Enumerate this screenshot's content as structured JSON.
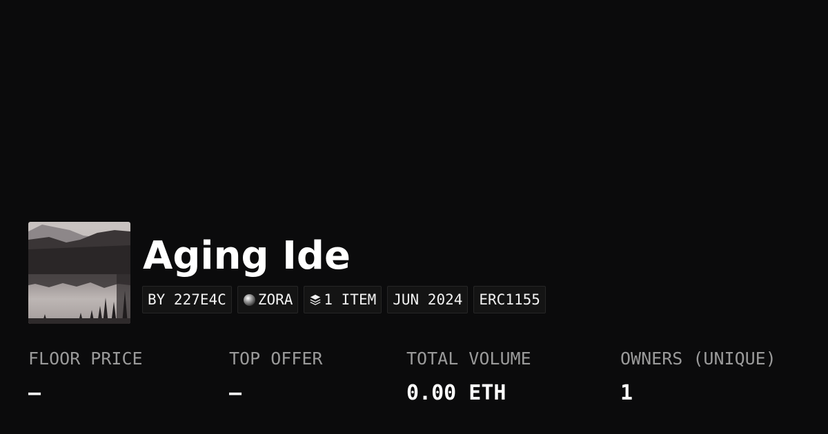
{
  "collection": {
    "title": "Aging Ide",
    "thumbnail_icon": "landscape-lake-forest-image"
  },
  "tags": {
    "creator": "BY 227E4C",
    "chain": "ZORA",
    "chain_icon": "sphere-icon",
    "items": "1 ITEM",
    "items_icon": "layers-icon",
    "date": "JUN 2024",
    "standard": "ERC1155"
  },
  "stats": [
    {
      "label": "FLOOR PRICE",
      "value": "–"
    },
    {
      "label": "TOP OFFER",
      "value": "–"
    },
    {
      "label": "TOTAL VOLUME",
      "value": "0.00 ETH"
    },
    {
      "label": "OWNERS (UNIQUE)",
      "value": "1"
    }
  ],
  "colors": {
    "background": "#0b0b0c",
    "tag_background": "#141414",
    "label_gray": "#9a9a9a"
  }
}
